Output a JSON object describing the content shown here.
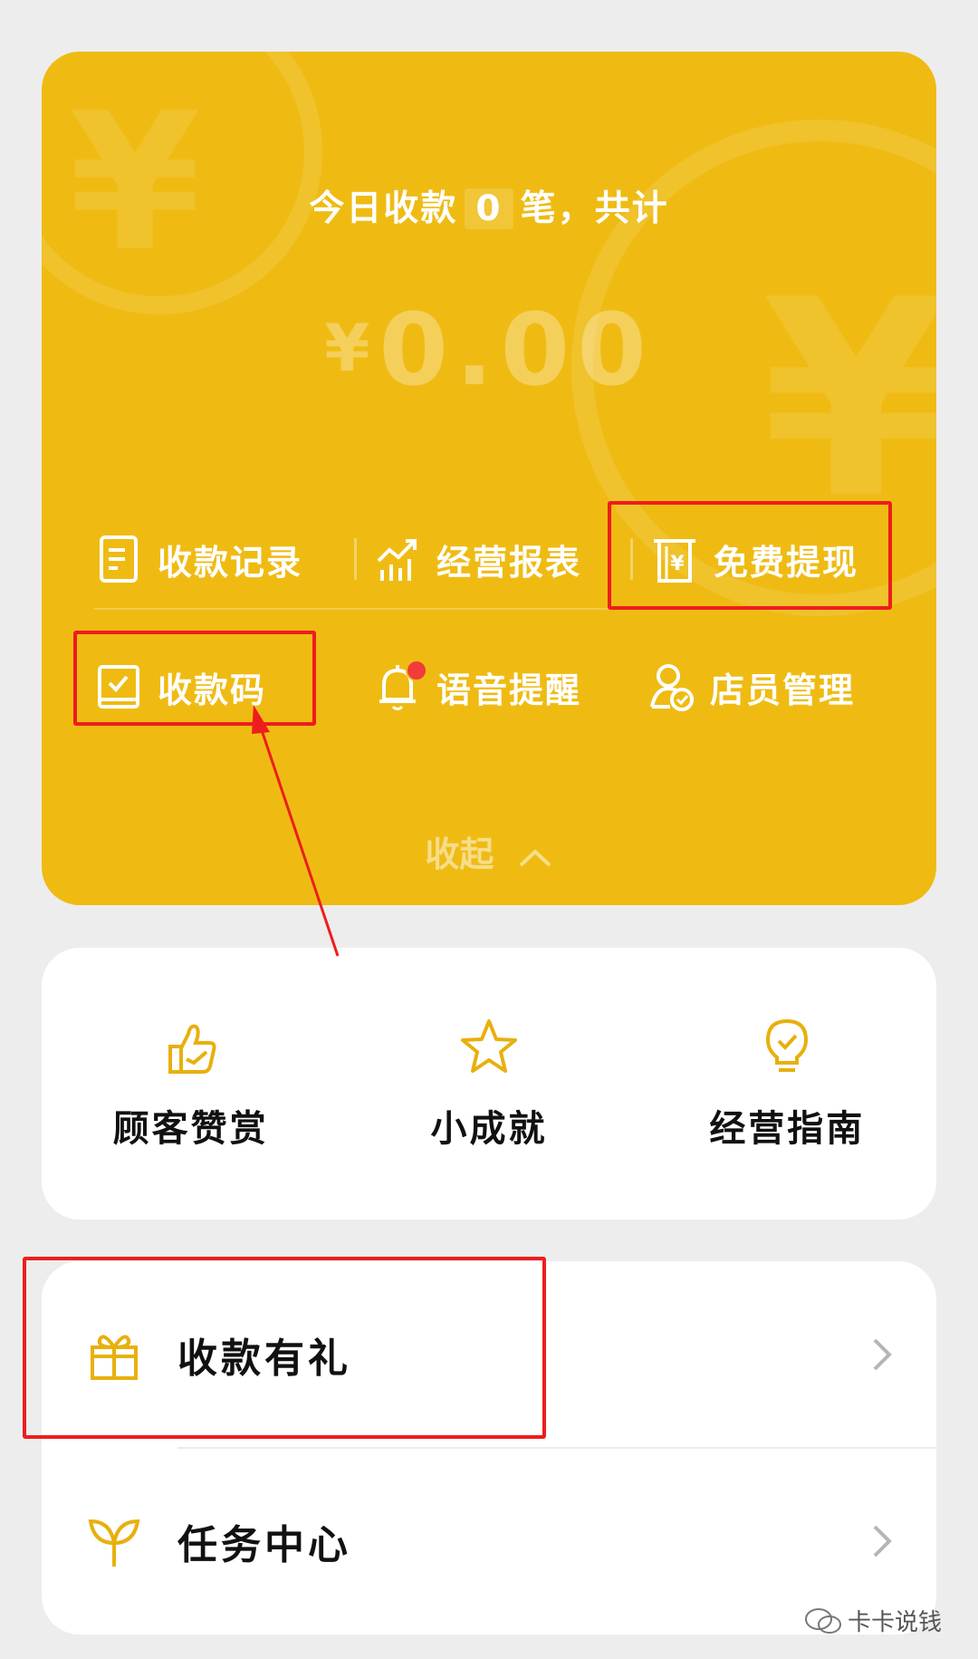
{
  "summary": {
    "prefix": "今日收款",
    "count": "0",
    "suffix": "笔，共计"
  },
  "amount": {
    "currency": "¥",
    "value": "0.00"
  },
  "functions_row1": [
    {
      "label": "收款记录",
      "icon": "document-icon"
    },
    {
      "label": "经营报表",
      "icon": "chart-icon"
    },
    {
      "label": "免费提现",
      "icon": "withdraw-icon"
    }
  ],
  "functions_row2": [
    {
      "label": "收款码",
      "icon": "qr-code-icon"
    },
    {
      "label": "语音提醒",
      "icon": "bell-icon"
    },
    {
      "label": "店员管理",
      "icon": "staff-icon"
    }
  ],
  "collapse": {
    "label": "收起"
  },
  "grid": [
    {
      "label": "顾客赞赏",
      "icon": "thumbs-up-icon"
    },
    {
      "label": "小成就",
      "icon": "star-icon"
    },
    {
      "label": "经营指南",
      "icon": "lightbulb-icon"
    }
  ],
  "list": [
    {
      "label": "收款有礼",
      "icon": "gift-icon"
    },
    {
      "label": "任务中心",
      "icon": "sprout-icon"
    }
  ],
  "watermark": {
    "text": "卡卡说钱"
  },
  "colors": {
    "brand_yellow": "#efbb13",
    "highlight_red": "#ee1d1d",
    "icon_yellow": "#e8b00d"
  }
}
